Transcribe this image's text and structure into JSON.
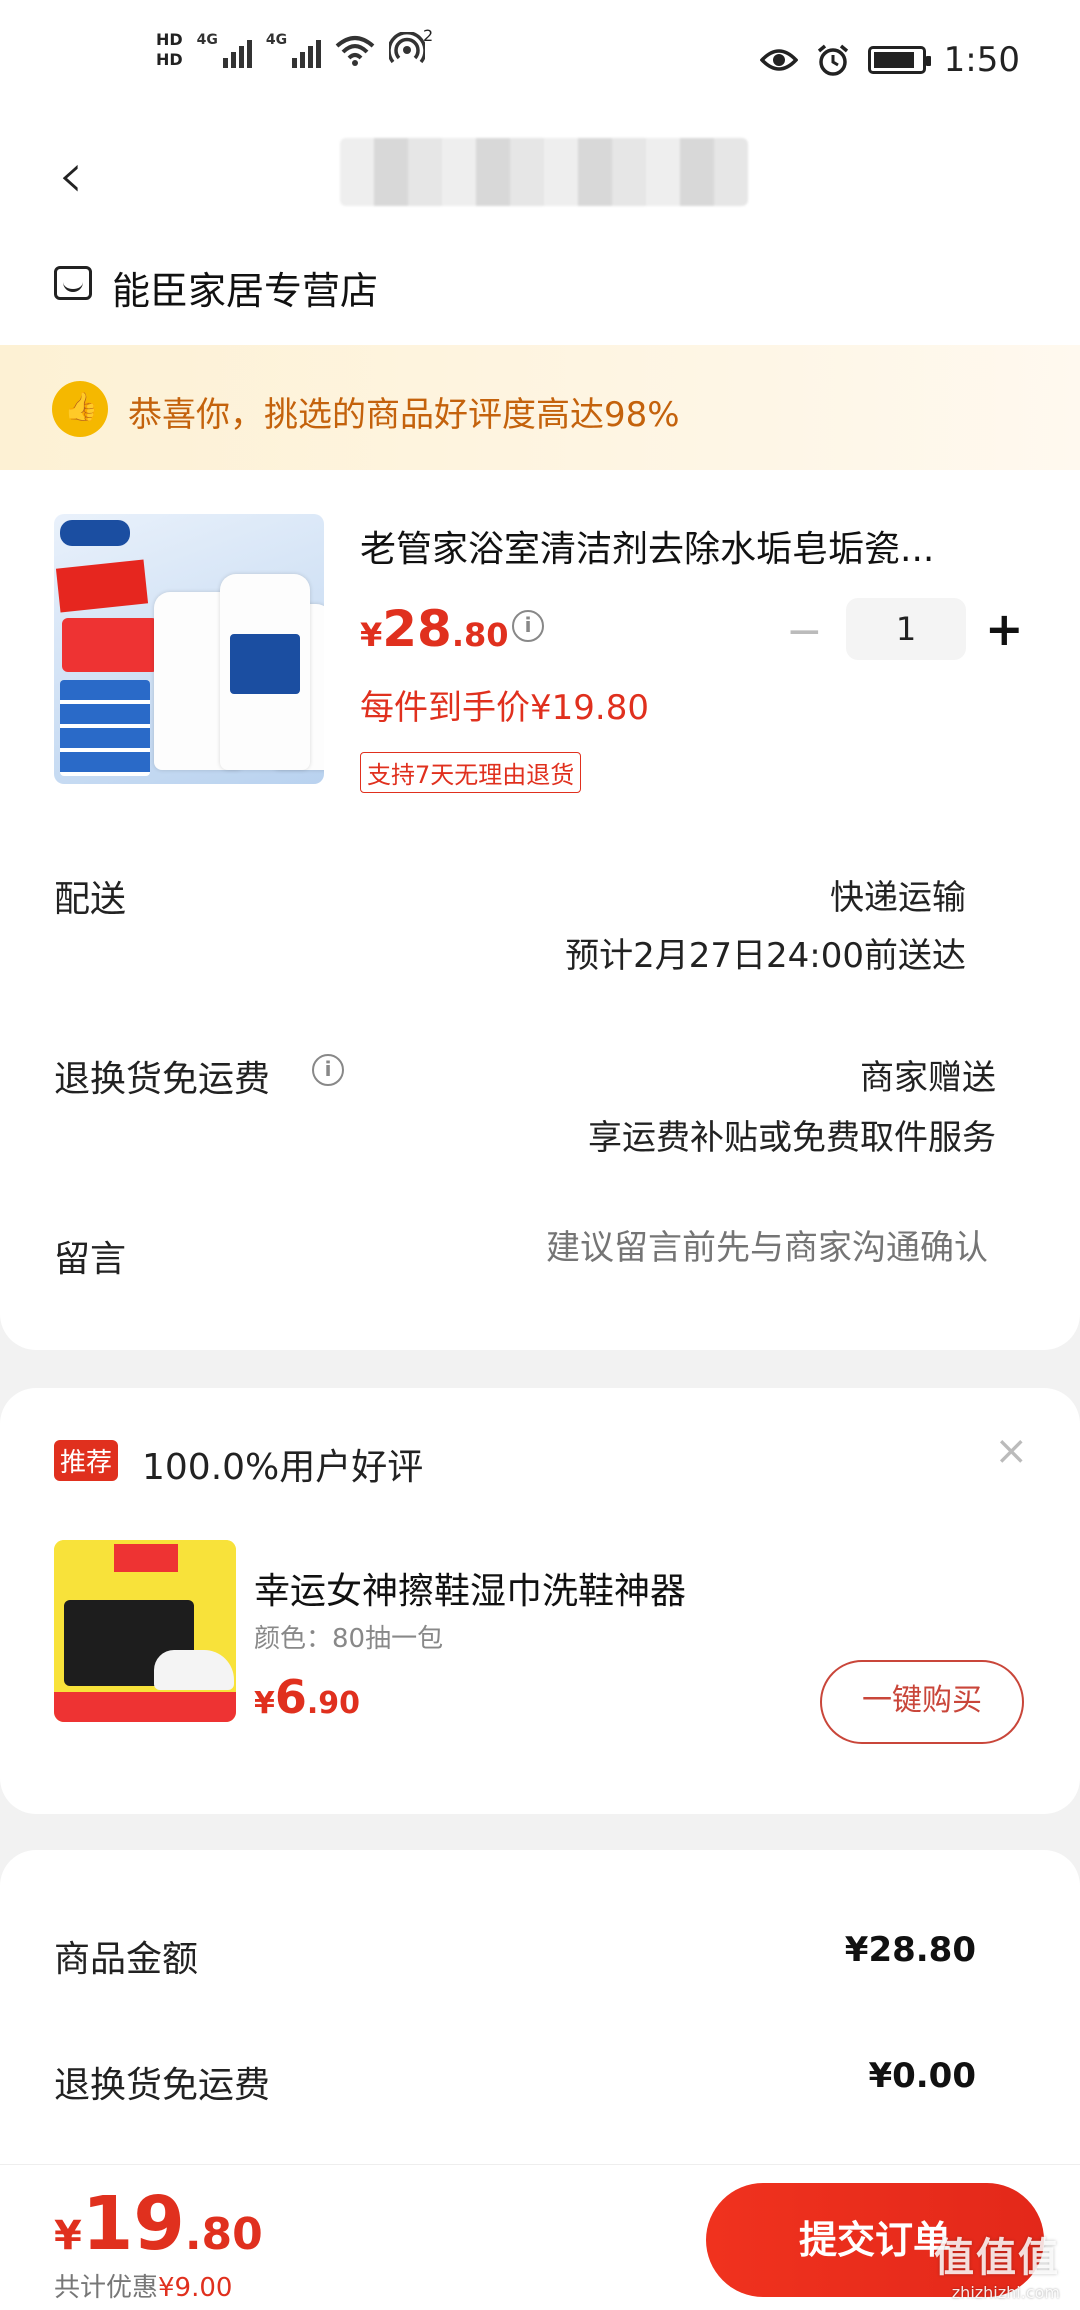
{
  "status_bar": {
    "hd1": "HD",
    "hd2": "HD",
    "net1": "4G",
    "net2": "4G",
    "hotspot_count": "2",
    "time": "1:50"
  },
  "nav": {
    "back_icon": "chevron-left"
  },
  "store": {
    "name": "能臣家居专营店"
  },
  "banner": {
    "text": "恭喜你，挑选的商品好评度高达98%"
  },
  "product": {
    "title": "老管家浴室清洁剂去除水垢皂垢瓷...",
    "price_currency": "¥",
    "price_int": "28",
    "price_dec": ".80",
    "quantity": "1",
    "unit_price": "每件到手价¥19.80",
    "return_tag": "支持7天无理由退货"
  },
  "shipping": {
    "label": "配送",
    "method": "快递运输",
    "eta": "预计2月27日24:00前送达"
  },
  "return_shipping": {
    "label": "退换货免运费",
    "value": "商家赠送",
    "description": "享运费补贴或免费取件服务"
  },
  "message": {
    "label": "留言",
    "placeholder": "建议留言前先与商家沟通确认"
  },
  "recommendation": {
    "badge": "推荐",
    "title": "100.0%用户好评",
    "item_name": "幸运女神擦鞋湿巾洗鞋神器",
    "item_color": "颜色：80抽一包",
    "price_currency": "¥",
    "price_int": "6",
    "price_dec": ".90",
    "buy_label": "一键购买"
  },
  "summary": {
    "goods_label": "商品金额",
    "goods_value": "¥28.80",
    "return_label": "退换货免运费",
    "return_value": "¥0.00"
  },
  "bottom_bar": {
    "total_currency": "¥",
    "total_int": "19",
    "total_dec": ".80",
    "discount_label": "共计优惠",
    "discount_amount": "¥9.00",
    "submit_label": "提交订单",
    "watermark": "值值值",
    "watermark_url": "zhizhizhi.com"
  },
  "colors": {
    "accent_red": "#e0301e",
    "banner_text": "#c4620c",
    "banner_bg": "#fdf1d4"
  }
}
